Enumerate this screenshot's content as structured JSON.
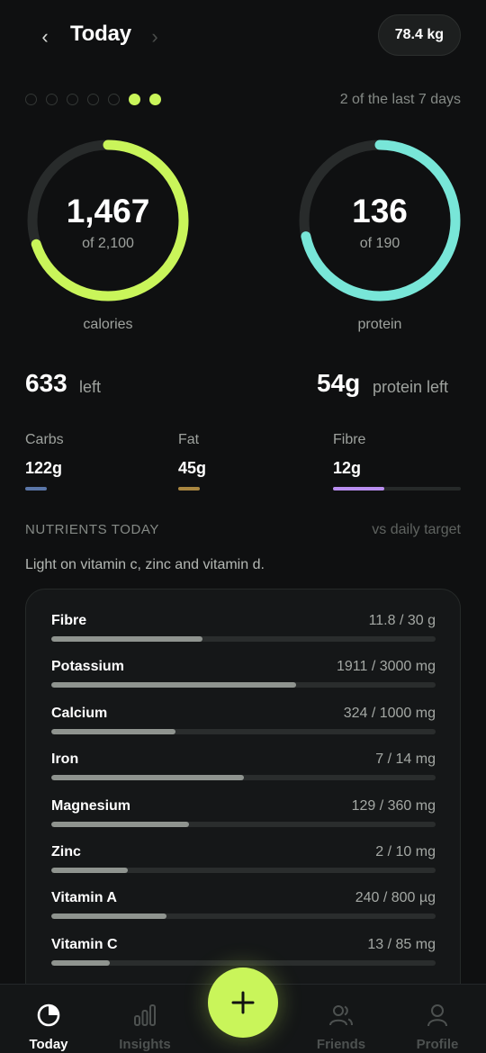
{
  "header": {
    "prev_icon": "chevron-left-icon",
    "title": "Today",
    "next_icon": "chevron-right-icon",
    "weight": "78.4 kg"
  },
  "streak": {
    "days": [
      false,
      false,
      false,
      false,
      false,
      true,
      true
    ],
    "label": "2 of the last 7 days",
    "active_color": "#c9f55a"
  },
  "rings": {
    "calories": {
      "value": "1,467",
      "of": "of 2,100",
      "caption": "calories",
      "progress": 0.699,
      "color": "#c9f55a"
    },
    "protein": {
      "value": "136",
      "of": "of 190",
      "caption": "protein",
      "progress": 0.716,
      "color": "#78e6d8"
    }
  },
  "summary": {
    "calories_left_value": "633",
    "calories_left_label": "left",
    "protein_left_value": "54g",
    "protein_left_label": "protein left"
  },
  "macros": [
    {
      "label": "Carbs",
      "amount": "122g",
      "color": "#5a76a8",
      "progress": 1.0
    },
    {
      "label": "Fat",
      "amount": "45g",
      "color": "#a98640",
      "progress": 1.0
    },
    {
      "label": "Fibre",
      "amount": "12g",
      "color": "#b98ef0",
      "progress": 0.4
    }
  ],
  "nutrients": {
    "heading": "NUTRIENTS TODAY",
    "vs_label": "vs daily target",
    "note": "Light on vitamin c, zinc and vitamin d.",
    "items": [
      {
        "name": "Fibre",
        "amount": "11.8 / 30 g",
        "progress": 0.393
      },
      {
        "name": "Potassium",
        "amount": "1911 / 3000 mg",
        "progress": 0.637
      },
      {
        "name": "Calcium",
        "amount": "324 / 1000 mg",
        "progress": 0.324
      },
      {
        "name": "Iron",
        "amount": "7 / 14 mg",
        "progress": 0.5
      },
      {
        "name": "Magnesium",
        "amount": "129 / 360 mg",
        "progress": 0.358
      },
      {
        "name": "Zinc",
        "amount": "2 / 10 mg",
        "progress": 0.2
      },
      {
        "name": "Vitamin A",
        "amount": "240 / 800 µg",
        "progress": 0.3
      },
      {
        "name": "Vitamin C",
        "amount": "13 / 85 mg",
        "progress": 0.153
      }
    ]
  },
  "nav": {
    "tabs": [
      {
        "label": "Today",
        "icon": "today-ring-icon",
        "active": true
      },
      {
        "label": "Insights",
        "icon": "bar-chart-icon",
        "active": false
      },
      {
        "label": "Friends",
        "icon": "friends-icon",
        "active": false
      },
      {
        "label": "Profile",
        "icon": "profile-icon",
        "active": false
      }
    ],
    "add_icon": "plus-icon"
  }
}
